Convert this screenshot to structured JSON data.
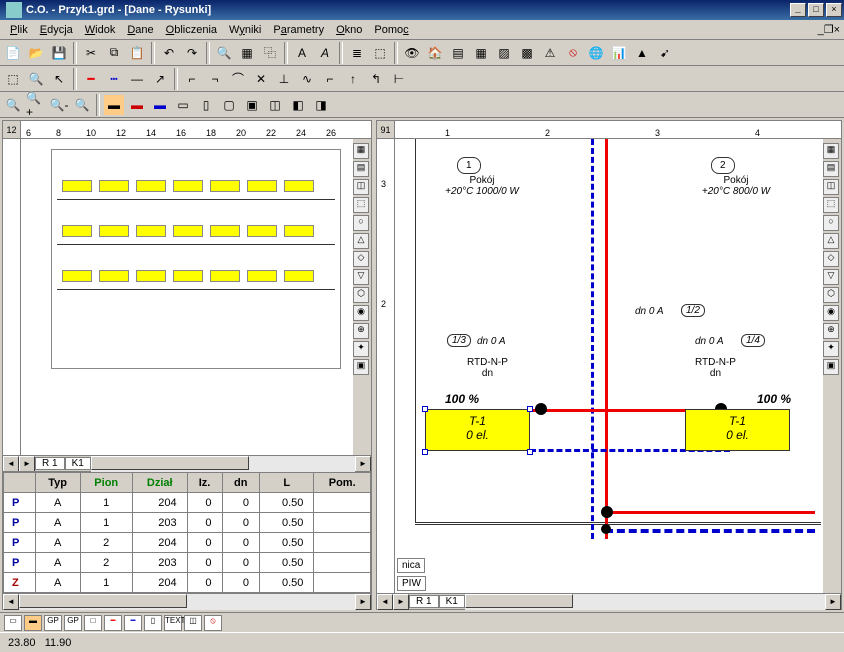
{
  "window": {
    "title": "C.O.  - Przyk1.grd - [Dane - Rysunki]"
  },
  "menu": [
    "Plik",
    "Edycja",
    "Widok",
    "Dane",
    "Obliczenia",
    "Wyniki",
    "Parametry",
    "Okno",
    "Pomoc"
  ],
  "status": {
    "x": "23.80",
    "y": "11.90"
  },
  "tabs_left": [
    "R 1",
    "K1"
  ],
  "tabs_right": [
    "R 1",
    "K1"
  ],
  "bottom_tabs_right": [
    "PIW",
    "nica"
  ],
  "grid": {
    "headers": [
      "",
      "Typ",
      "Pion",
      "Dział",
      "Iz.",
      "dn",
      "L",
      "Pom."
    ],
    "header_green": [
      2,
      3
    ],
    "rows": [
      {
        "c": "P",
        "typ": "A",
        "pion": "1",
        "dzial": "204",
        "iz": "0",
        "dn": "0",
        "l": "0.50",
        "pom": ""
      },
      {
        "c": "P",
        "typ": "A",
        "pion": "1",
        "dzial": "203",
        "iz": "0",
        "dn": "0",
        "l": "0.50",
        "pom": ""
      },
      {
        "c": "P",
        "typ": "A",
        "pion": "2",
        "dzial": "204",
        "iz": "0",
        "dn": "0",
        "l": "0.50",
        "pom": ""
      },
      {
        "c": "P",
        "typ": "A",
        "pion": "2",
        "dzial": "203",
        "iz": "0",
        "dn": "0",
        "l": "0.50",
        "pom": ""
      },
      {
        "c": "Z",
        "typ": "A",
        "pion": "1",
        "dzial": "204",
        "iz": "0",
        "dn": "0",
        "l": "0.50",
        "pom": ""
      }
    ]
  },
  "ruler_left": {
    "corner": "12",
    "ticks": [
      "6",
      "8",
      "10",
      "12",
      "14",
      "16",
      "18",
      "20",
      "22",
      "24",
      "26"
    ]
  },
  "ruler_right": {
    "corner": "91",
    "ticks": [
      "1",
      "2",
      "3",
      "4"
    ]
  },
  "rooms": [
    {
      "num": "1",
      "name": "Pokój",
      "spec": "+20°C 1000/0 W"
    },
    {
      "num": "2",
      "name": "Pokój",
      "spec": "+20°C 800/0 W"
    }
  ],
  "radiators": [
    {
      "id": "T-1",
      "el": "0 el.",
      "pct": "100 %"
    },
    {
      "id": "T-1",
      "el": "0 el.",
      "pct": "100 %"
    }
  ],
  "valves": {
    "label": "RTD-N-P",
    "dn": "dn"
  },
  "pipes": [
    {
      "lbl": "dn 0 A",
      "tag": "1/2"
    },
    {
      "lbl": "dn 0 A",
      "tag": "1/3"
    },
    {
      "lbl": "dn 0 A",
      "tag": "1/4"
    }
  ]
}
